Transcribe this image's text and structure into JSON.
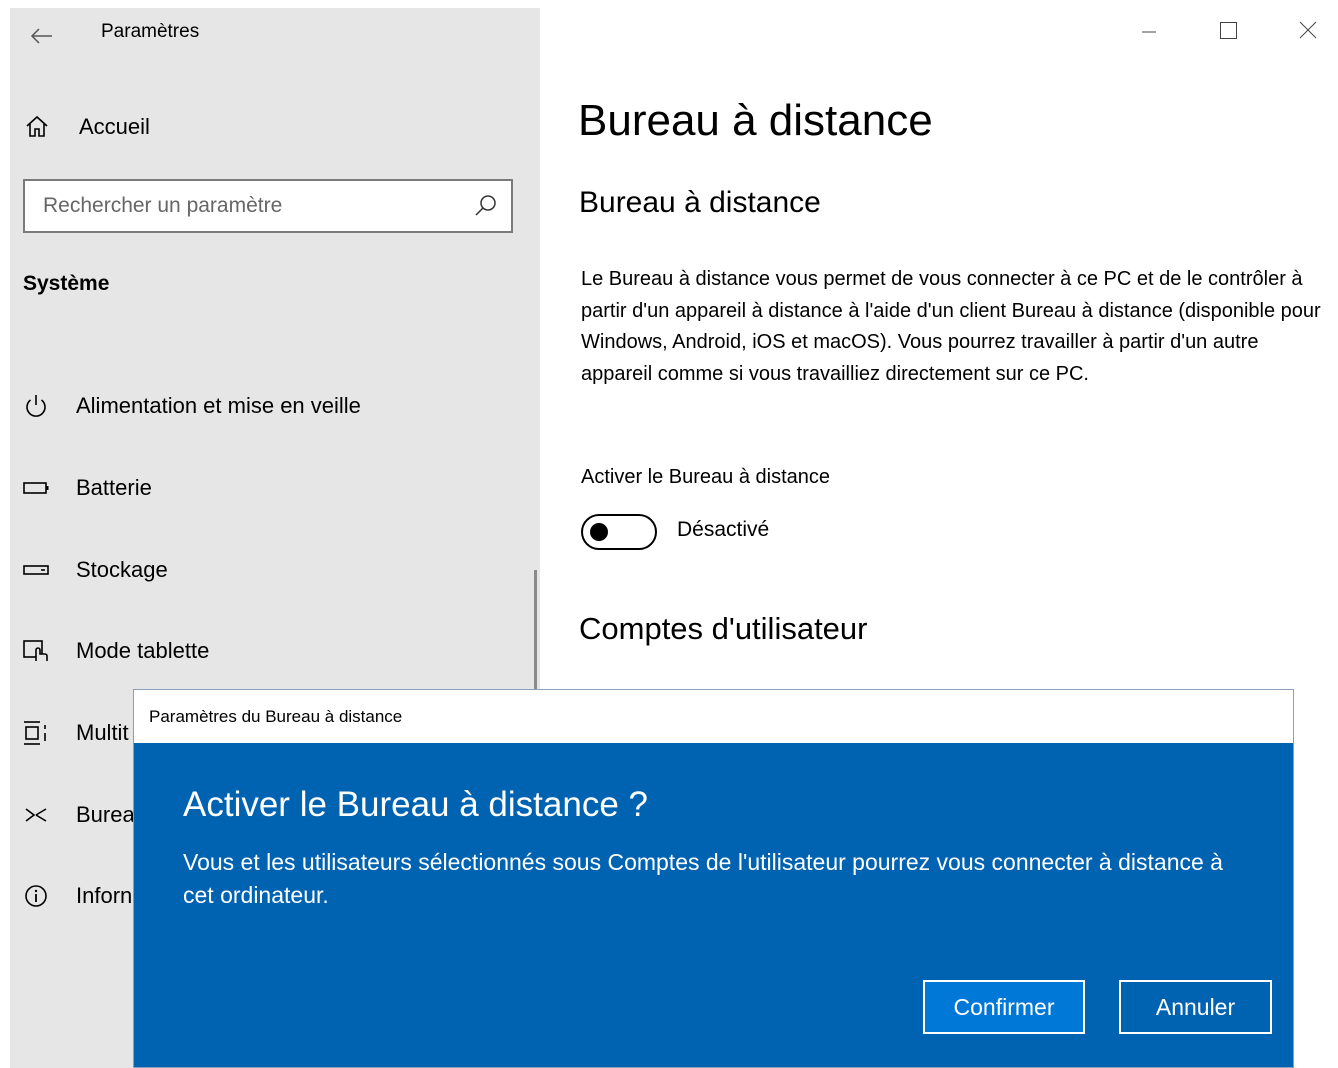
{
  "window": {
    "app_title": "Paramètres"
  },
  "sidebar": {
    "home_label": "Accueil",
    "search_placeholder": "Rechercher un paramètre",
    "section_title": "Système",
    "items": [
      {
        "label": "Alimentation et mise en veille",
        "icon": "power-icon"
      },
      {
        "label": "Batterie",
        "icon": "battery-icon"
      },
      {
        "label": "Stockage",
        "icon": "storage-icon"
      },
      {
        "label": "Mode tablette",
        "icon": "tablet-mode-icon"
      },
      {
        "label": "Multit",
        "icon": "multitasking-icon"
      },
      {
        "label": "Burea",
        "icon": "remote-desktop-icon"
      },
      {
        "label": "Inforn",
        "icon": "info-icon"
      }
    ]
  },
  "main": {
    "page_title": "Bureau à distance",
    "section_title": "Bureau à distance",
    "description": "Le Bureau à distance vous permet de vous connecter à ce PC et de le contrôler à partir d'un appareil à distance à l'aide d'un client Bureau à distance (disponible pour Windows, Android, iOS et macOS). Vous pourrez travailler à partir d'un autre appareil comme si vous travailliez directement sur ce PC.",
    "toggle_label": "Activer le Bureau à distance",
    "toggle_state": "Désactivé",
    "toggle_on": false,
    "accounts_title": "Comptes d'utilisateur"
  },
  "dialog": {
    "window_title": "Paramètres du Bureau à distance",
    "heading": "Activer le Bureau à distance ?",
    "message": "Vous et les utilisateurs sélectionnés sous Comptes de l'utilisateur pourrez vous connecter à distance à cet ordinateur.",
    "confirm_label": "Confirmer",
    "cancel_label": "Annuler"
  },
  "colors": {
    "sidebar_bg": "#e6e6e6",
    "dialog_bg": "#0063b1",
    "confirm_bg": "#0078d7"
  }
}
